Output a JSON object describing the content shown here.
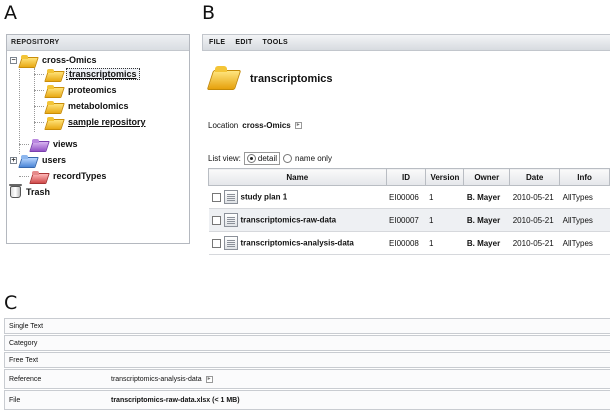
{
  "panels": {
    "a": "A",
    "b": "B",
    "c": "C"
  },
  "repository": {
    "header": "Repository",
    "tree": [
      {
        "label": "cross-Omics",
        "expander": "−"
      },
      {
        "label": "transcriptomics"
      },
      {
        "label": "proteomics"
      },
      {
        "label": "metabolomics"
      },
      {
        "label": "sample repository"
      },
      {
        "label": "views"
      },
      {
        "label": "users",
        "expander": "+"
      },
      {
        "label": "recordTypes"
      },
      {
        "label": "Trash"
      }
    ],
    "selected": "transcriptomics"
  },
  "menu": {
    "file": "File",
    "edit": "Edit",
    "tools": "Tools"
  },
  "folder": {
    "title": "transcriptomics",
    "location_label": "Location",
    "location_value": "cross-Omics",
    "list_view_label": "List view:",
    "view_detail": "detail",
    "view_name_only": "name only",
    "view_selected": "detail"
  },
  "table": {
    "columns": [
      "Name",
      "ID",
      "Version",
      "Owner",
      "Date",
      "Info"
    ],
    "rows": [
      {
        "name": "study plan 1",
        "id": "EI00006",
        "version": "1",
        "owner": "B. Mayer",
        "date": "2010-05-21",
        "info": "AllTypes"
      },
      {
        "name": "transcriptomics-raw-data",
        "id": "EI00007",
        "version": "1",
        "owner": "B. Mayer",
        "date": "2010-05-21",
        "info": "AllTypes"
      },
      {
        "name": "transcriptomics-analysis-data",
        "id": "EI00008",
        "version": "1",
        "owner": "B. Mayer",
        "date": "2010-05-21",
        "info": "AllTypes"
      }
    ]
  },
  "record": {
    "fields": [
      {
        "label": "Single Text",
        "value": ""
      },
      {
        "label": "Category",
        "value": ""
      },
      {
        "label": "Free Text",
        "value": ""
      },
      {
        "label": "Reference",
        "value": "transcriptomics-analysis-data"
      },
      {
        "label": "File",
        "value": "transcriptomics-raw-data.xlsx (< 1 MB)"
      }
    ]
  }
}
